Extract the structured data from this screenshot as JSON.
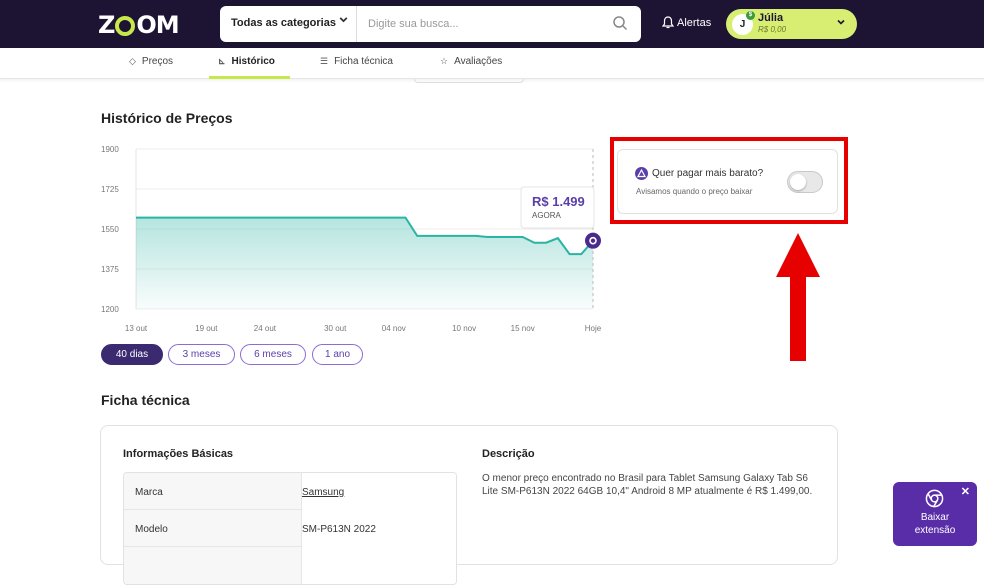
{
  "header": {
    "logo": "ZOOM",
    "category_label": "Todas as categorias",
    "search_placeholder": "Digite sua busca...",
    "alerts_label": "Alertas",
    "user_initial": "J",
    "user_name": "Júlia",
    "user_balance": "R$ 0,00"
  },
  "tabs": [
    {
      "label": "Preços",
      "icon": "tag-icon"
    },
    {
      "label": "Histórico",
      "icon": "chart-icon",
      "active": true
    },
    {
      "label": "Ficha técnica",
      "icon": "list-icon"
    },
    {
      "label": "Avaliações",
      "icon": "star-icon"
    }
  ],
  "history": {
    "title": "Histórico de Preços",
    "current_price": "R$ 1.499",
    "current_label": "AGORA",
    "ranges": [
      "40 dias",
      "3 meses",
      "6 meses",
      "1 ano"
    ],
    "active_range": "40 dias"
  },
  "chart_data": {
    "type": "area",
    "title": "",
    "xlabel": "",
    "ylabel": "",
    "ylim": [
      1200,
      1900
    ],
    "y_ticks": [
      1900,
      1725,
      1550,
      1375,
      1200
    ],
    "x_tick_labels": [
      "13 out",
      "19 out",
      "24 out",
      "30 out",
      "04 nov",
      "10 nov",
      "15 nov",
      "Hoje"
    ],
    "x": [
      0,
      23,
      24,
      29,
      30,
      33,
      34,
      35,
      36,
      37,
      38,
      39
    ],
    "values": [
      1600,
      1600,
      1520,
      1520,
      1515,
      1515,
      1490,
      1490,
      1510,
      1440,
      1440,
      1499
    ],
    "series_color": "#2bb3a3",
    "grid": true
  },
  "alert_card": {
    "title": "Quer pagar mais barato?",
    "subtitle": "Avisamos quando o preço baixar",
    "toggle_on": false
  },
  "ficha": {
    "title": "Ficha técnica",
    "info_title": "Informações Básicas",
    "rows": [
      {
        "key": "Marca",
        "value": "Samsung",
        "link": true
      },
      {
        "key": "Modelo",
        "value": "SM-P613N 2022",
        "link": false
      }
    ],
    "desc_title": "Descrição",
    "desc_text": "O menor preço encontrado no Brasil para Tablet Samsung Galaxy Tab S6 Lite SM-P613N 2022 64GB 10,4\" Android 8 MP atualmente é R$ 1.499,00."
  },
  "extension": {
    "label_line1": "Baixar",
    "label_line2": "extensão"
  },
  "colors": {
    "header_bg": "#1d1333",
    "accent_lime": "#c6e84a",
    "accent_purple": "#5a3fa8",
    "annotation_red": "#e60000"
  }
}
